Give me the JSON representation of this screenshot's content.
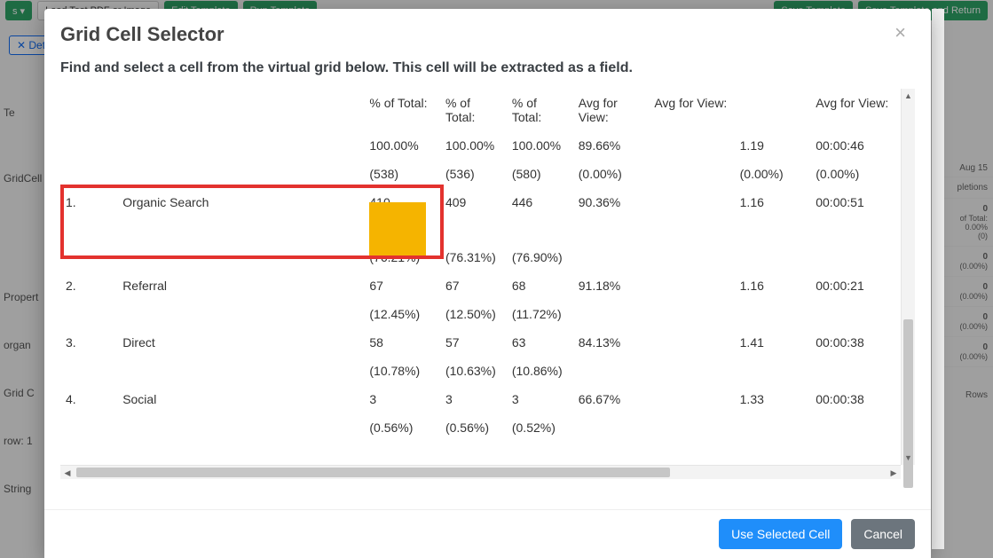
{
  "bg": {
    "toolbar": {
      "btn_load": "Load Test PDF or Image",
      "btn_edit": "Edit Template",
      "btn_run": "Run Template",
      "btn_save": "Save Template",
      "btn_save_return": "Save Template and Return",
      "dropdown_suffix": "s ▾"
    },
    "delete_btn": "✕ Dete",
    "left_labels": [
      "Te",
      "GridCell",
      "Propert",
      "organ",
      "Grid C",
      "row: 1",
      "String"
    ],
    "right": {
      "date": "Aug 15",
      "col_label": "pletions",
      "cells": [
        {
          "main": "0",
          "sub": "of Total:\n0.00%\n(0)"
        },
        {
          "main": "0",
          "sub": "(0.00%)"
        },
        {
          "main": "0",
          "sub": "(0.00%)"
        },
        {
          "main": "0",
          "sub": "(0.00%)"
        },
        {
          "main": "0",
          "sub": "(0.00%)"
        }
      ],
      "rows_label": "Rows"
    }
  },
  "modal": {
    "title": "Grid Cell Selector",
    "instructions": "Find and select a cell from the virtual grid below. This cell will be extracted as a field.",
    "use_btn": "Use Selected Cell",
    "cancel_btn": "Cancel"
  },
  "grid": {
    "headers": {
      "pct1": "% of Total:",
      "pct2": "% of Total:",
      "pct3": "% of Total:",
      "avg1": "Avg for View:",
      "avg2": "Avg for View:",
      "avg3": "Avg for View:"
    },
    "totals": {
      "pct1_a": "100.00%",
      "pct1_b": "(538)",
      "pct2_a": "100.00%",
      "pct2_b": "(536)",
      "pct3_a": "100.00%",
      "pct3_b": "(580)",
      "avg1_a": "89.66%",
      "avg1_b": "(0.00%)",
      "avg2_a": "1.19",
      "avg2_b": "(0.00%)",
      "avg3_a": "00:00:46",
      "avg3_b": "(0.00%)"
    },
    "rows": [
      {
        "idx": "1.",
        "name": "Organic Search",
        "pct1_a": "410",
        "pct1_b": "(76.21%)",
        "pct2_a": "409",
        "pct2_b": "(76.31%)",
        "pct3_a": "446",
        "pct3_b": "(76.90%)",
        "avg1_a": "90.36%",
        "avg2_a": "1.16",
        "avg3_a": "00:00:51"
      },
      {
        "idx": "2.",
        "name": "Referral",
        "pct1_a": "67",
        "pct1_b": "(12.45%)",
        "pct2_a": "67",
        "pct2_b": "(12.50%)",
        "pct3_a": "68",
        "pct3_b": "(11.72%)",
        "avg1_a": "91.18%",
        "avg2_a": "1.16",
        "avg3_a": "00:00:21"
      },
      {
        "idx": "3.",
        "name": "Direct",
        "pct1_a": "58",
        "pct1_b": "(10.78%)",
        "pct2_a": "57",
        "pct2_b": "(10.63%)",
        "pct3_a": "63",
        "pct3_b": "(10.86%)",
        "avg1_a": "84.13%",
        "avg2_a": "1.41",
        "avg3_a": "00:00:38"
      },
      {
        "idx": "4.",
        "name": "Social",
        "pct1_a": "3",
        "pct1_b": "(0.56%)",
        "pct2_a": "3",
        "pct2_b": "(0.56%)",
        "pct3_a": "3",
        "pct3_b": "(0.52%)",
        "avg1_a": "66.67%",
        "avg2_a": "1.33",
        "avg3_a": "00:00:38"
      }
    ]
  },
  "selection": {
    "row": 0,
    "col_key": "pct1_a"
  }
}
